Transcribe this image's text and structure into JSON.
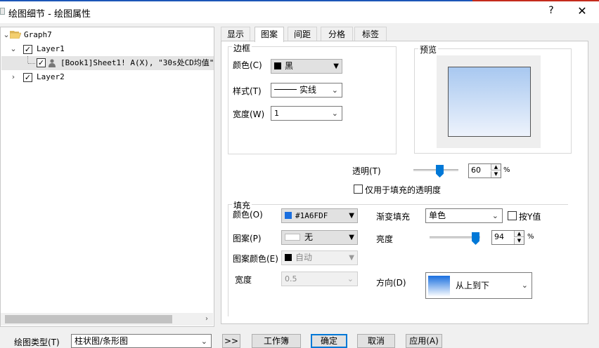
{
  "window": {
    "title": "绘图细节 - 绘图属性",
    "help": "?",
    "close": "✕"
  },
  "tree": {
    "items": [
      {
        "label": "Graph7"
      },
      {
        "label": "Layer1"
      },
      {
        "label": "[Book1]Sheet1! A(X), \"30s处CD均值\"(Y"
      },
      {
        "label": "Layer2"
      }
    ]
  },
  "tabs": [
    "显示",
    "图案",
    "间距",
    "分格",
    "标签"
  ],
  "border": {
    "group_label": "边框",
    "color_label": "颜色(C)",
    "color_value": "黑",
    "color_hex": "#000000",
    "style_label": "样式(T)",
    "style_value": "实线",
    "width_label": "宽度(W)",
    "width_value": "1"
  },
  "preview": {
    "label": "预览",
    "fill_top": "#1A6FDF"
  },
  "transparency": {
    "label": "透明(T)",
    "value": "60",
    "unit": "%",
    "percent": 60
  },
  "fill_only": {
    "label": "仅用于填充的透明度"
  },
  "fill": {
    "group_label": "填充",
    "color_label": "颜色(O)",
    "color_value": "#1A6FDF",
    "color_hex": "#1A6FDF",
    "pattern_label": "图案(P)",
    "pattern_value": "无",
    "pattern_color_label": "图案颜色(E)",
    "pattern_color_value": "自动",
    "width_label": "宽度",
    "width_value": "0.5",
    "gradient_label": "渐变填充",
    "gradient_value": "单色",
    "by_y_label": "按Y值",
    "brightness_label": "亮度",
    "brightness_value": "94",
    "brightness_unit": "%",
    "brightness_percent": 94,
    "direction_label": "方向(D)",
    "direction_value": "从上到下"
  },
  "bottom": {
    "plot_type_label": "绘图类型(T)",
    "plot_type_value": "柱状图/条形图",
    "expand": ">>",
    "workbook": "工作簿",
    "ok": "确定",
    "cancel": "取消",
    "apply": "应用(A)"
  }
}
